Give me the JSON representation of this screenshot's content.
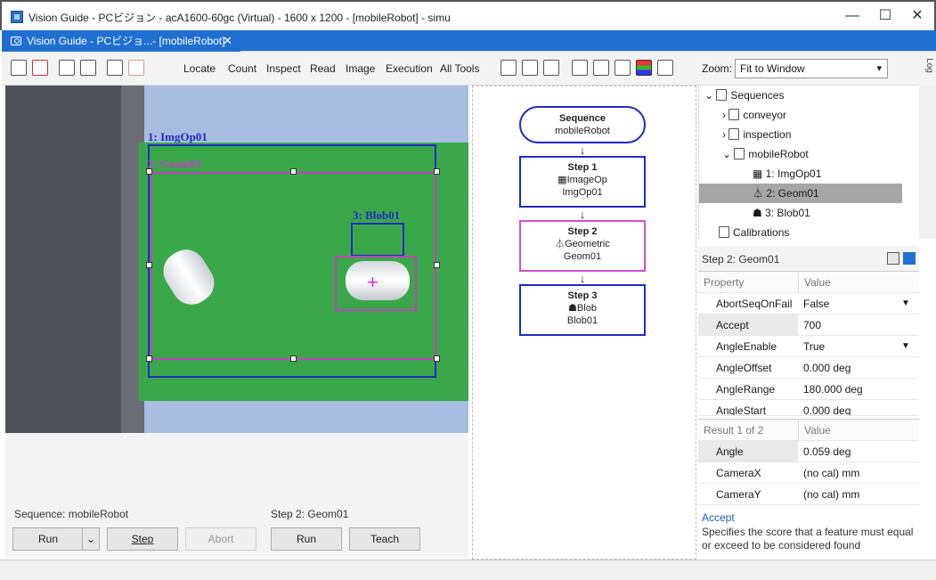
{
  "window": {
    "title": "Vision Guide - PCビジョン - acA1600-60gc (Virtual) - 1600 x 1200 - [mobileRobot] - simu",
    "tab_label": "Vision Guide - PCビジョ...- [mobileRobot]",
    "tab_close": "✕",
    "minimize": "—",
    "maximize": "☐",
    "close": "✕"
  },
  "toolbar": {
    "menus": [
      "Locate",
      "Count",
      "Inspect",
      "Read",
      "Image",
      "Execution",
      "All Tools"
    ],
    "zoom_label": "Zoom:",
    "zoom_value": "Fit to Window",
    "side_tab": "Log"
  },
  "image": {
    "labels": {
      "imgop": "1: ImgOp01",
      "geom": "2: Geom01",
      "blob": "3: Blob01"
    }
  },
  "flow": {
    "sequence": {
      "title": "Sequence",
      "name": "mobileRobot"
    },
    "steps": [
      {
        "title": "Step 1",
        "tool": "ImageOp",
        "name": "ImgOp01"
      },
      {
        "title": "Step 2",
        "tool": "Geometric",
        "name": "Geom01"
      },
      {
        "title": "Step 3",
        "tool": "Blob",
        "name": "Blob01"
      }
    ]
  },
  "tree": {
    "root": "Sequences",
    "items": [
      "conveyor",
      "inspection",
      "mobileRobot"
    ],
    "children": [
      "1: ImgOp01",
      "2: Geom01",
      "3: Blob01"
    ],
    "calibrations": "Calibrations"
  },
  "properties": {
    "title": "Step 2: Geom01",
    "header": {
      "property": "Property",
      "value": "Value"
    },
    "rows": [
      {
        "name": "AbortSeqOnFail",
        "value": "False"
      },
      {
        "name": "Accept",
        "value": "700"
      },
      {
        "name": "AngleEnable",
        "value": "True"
      },
      {
        "name": "AngleOffset",
        "value": "0.000 deg"
      },
      {
        "name": "AngleRange",
        "value": "180.000 deg"
      },
      {
        "name": "AngleStart",
        "value": "0.000 deg"
      }
    ]
  },
  "results": {
    "header": {
      "result": "Result 1 of 2",
      "value": "Value"
    },
    "rows": [
      {
        "name": "Angle",
        "value": "0.059 deg"
      },
      {
        "name": "CameraX",
        "value": "(no cal) mm"
      },
      {
        "name": "CameraY",
        "value": "(no cal) mm"
      }
    ]
  },
  "description": {
    "title": "Accept",
    "text": "Specifies the score that a feature must equal or exceed to be considered found"
  },
  "controls": {
    "sequence_label": "Sequence: mobileRobot",
    "step_label": "Step 2: Geom01",
    "run": "Run",
    "step": "Step",
    "abort": "Abort",
    "run2": "Run",
    "teach": "Teach"
  }
}
